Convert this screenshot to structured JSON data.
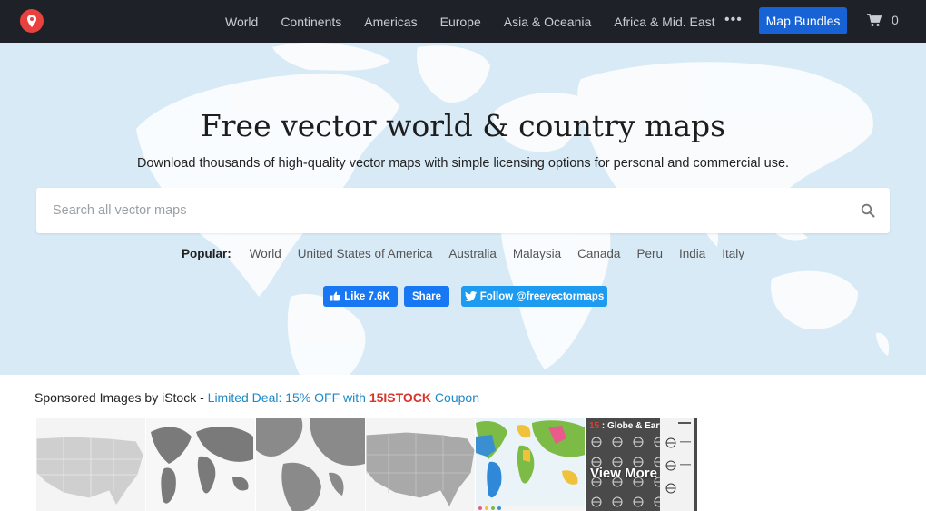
{
  "nav": {
    "logo_icon": "map-pin-icon",
    "links": [
      "World",
      "Continents",
      "Americas",
      "Europe",
      "Asia & Oceania",
      "Africa & Mid. East"
    ],
    "more_icon": "ellipsis-icon",
    "bundles_label": "Map Bundles",
    "cart_icon": "shopping-cart-icon",
    "cart_count": "0"
  },
  "hero": {
    "title": "Free vector world & country maps",
    "subtitle": "Download thousands of high-quality vector maps with simple licensing options for personal and commercial use.",
    "search_placeholder": "Search all vector maps",
    "search_icon": "search-icon",
    "popular_label": "Popular:",
    "popular_links": [
      "World",
      "United States of America",
      "Australia",
      "Malaysia",
      "Canada",
      "Peru",
      "India",
      "Italy"
    ],
    "like_label": "Like 7.6K",
    "share_label": "Share",
    "follow_label": "Follow @freevectormaps"
  },
  "sponsored": {
    "prefix": "Sponsored Images by iStock - ",
    "deal_text": "Limited Deal: 15% OFF with ",
    "code": "15ISTOCK",
    "suffix": " Coupon",
    "view_more_label": "View More",
    "thumb_6_title_num": "15",
    "thumb_6_title": " : Globe & Earth"
  },
  "colors": {
    "nav_bg": "#1e2228",
    "accent": "#1763d6",
    "hero_bg": "#d7eaf6",
    "brand_red": "#e8413e"
  }
}
